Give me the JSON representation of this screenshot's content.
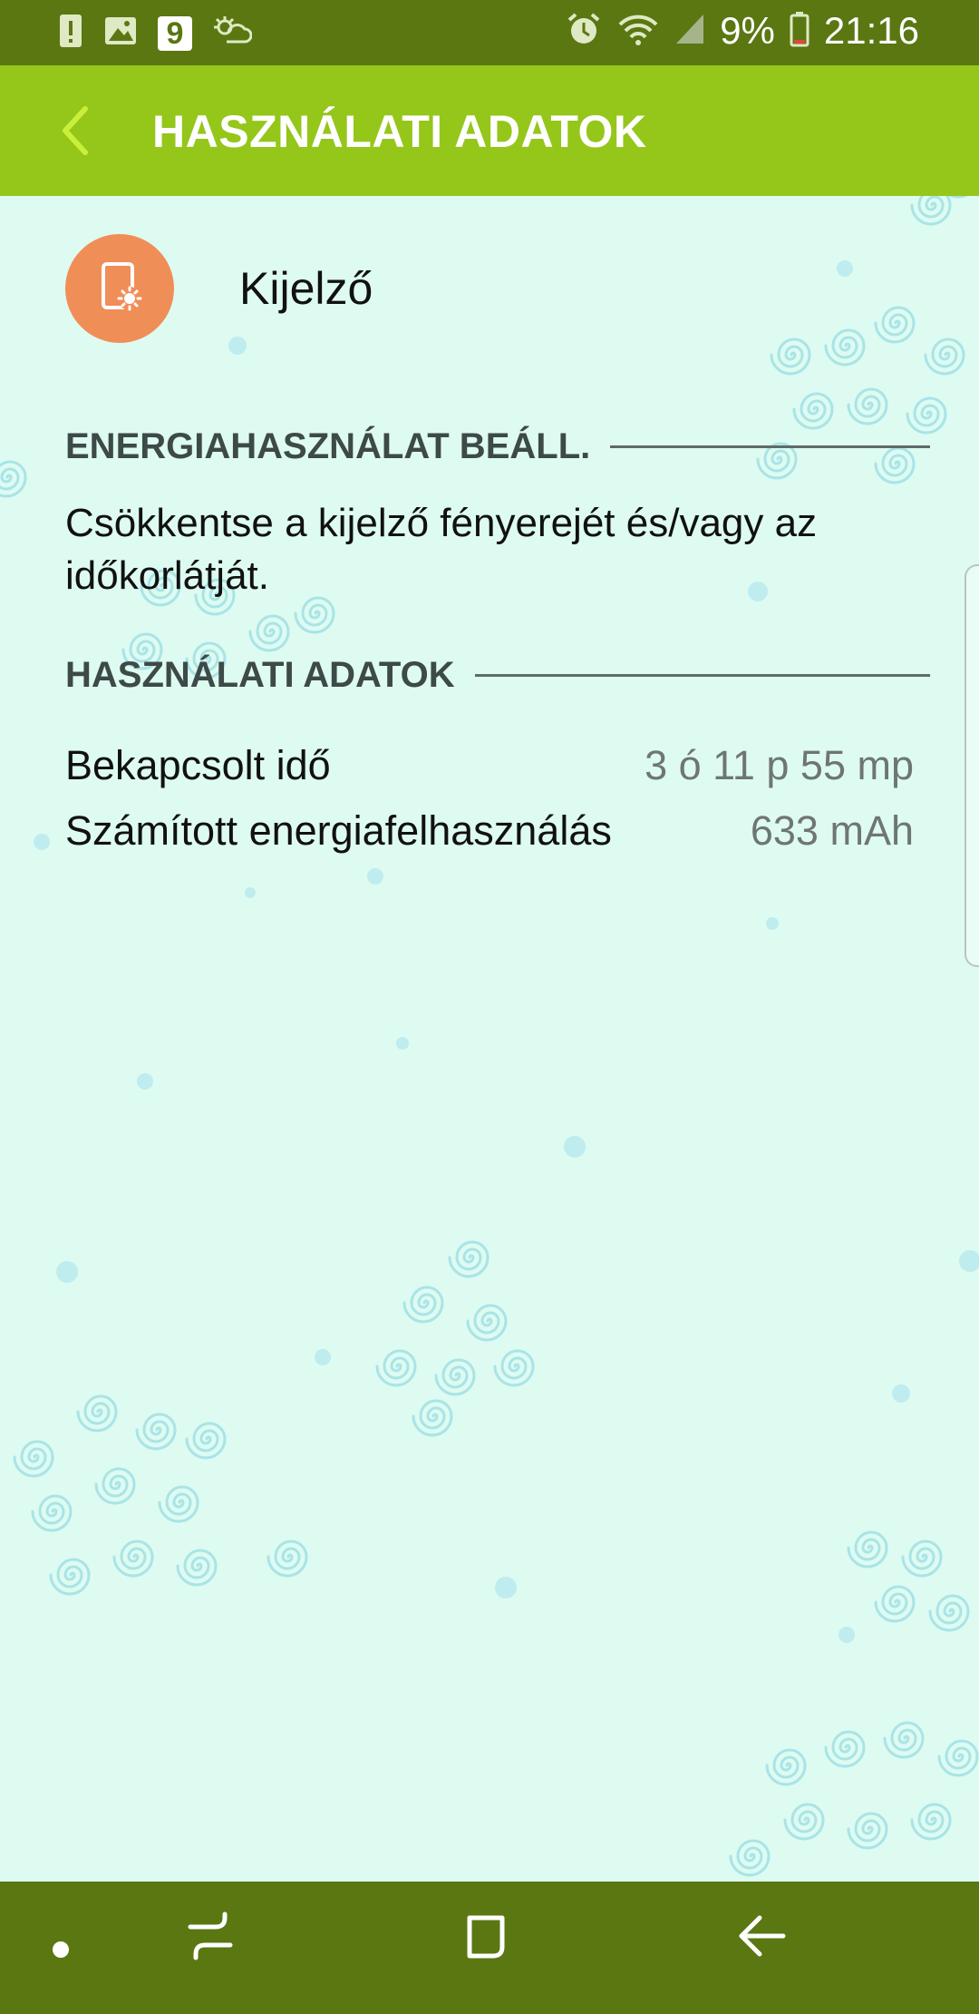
{
  "status_bar": {
    "notification_badge": "9",
    "battery_percent": "9%",
    "time": "21:16",
    "icons": [
      "alert-icon",
      "image-icon",
      "number-badge-icon",
      "weather-icon",
      "alarm-icon",
      "wifi-icon",
      "signal-icon",
      "battery-icon"
    ]
  },
  "app_bar": {
    "title": "HASZNÁLATI ADATOK",
    "back_icon": "chevron-left-icon"
  },
  "app": {
    "name": "Kijelző",
    "icon": "display-brightness-icon",
    "icon_color": "#f08e58"
  },
  "power_section": {
    "header": "ENERGIAHASZNÁLAT BEÁLL.",
    "text": "Csökkentse a kijelző fényerejét és/vagy az időkorlátját."
  },
  "usage_section": {
    "header": "HASZNÁLATI ADATOK",
    "rows": [
      {
        "label": "Bekapcsolt idő",
        "value": "3 ó 11 p 55 mp"
      },
      {
        "label": "Számított energiafelhasználás",
        "value": "633 mAh"
      }
    ]
  },
  "nav_bar": {
    "items": [
      "dot-icon",
      "recents-icon",
      "home-icon",
      "back-arrow-icon"
    ]
  },
  "colors": {
    "status_bar": "#5a7711",
    "app_bar": "#95c61a",
    "accent": "#c8f03a",
    "background": "#defbf1",
    "swirl": "#a9e4e7"
  }
}
